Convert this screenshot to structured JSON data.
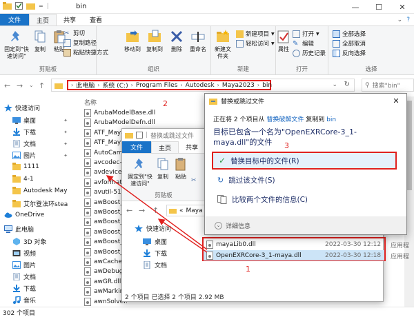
{
  "window": {
    "title": "bin"
  },
  "tabs": [
    "文件",
    "主页",
    "共享",
    "查看"
  ],
  "ribbon": {
    "clipboard": {
      "group": "剪贴板",
      "pin": "固定到\"快速访问\"",
      "copy": "复制",
      "paste": "粘贴",
      "cut": "剪切",
      "copy_path": "复制路径",
      "paste_shortcut": "粘贴快捷方式"
    },
    "organize": {
      "group": "组织",
      "move_to": "移动到",
      "copy_to": "复制到",
      "delete": "删除",
      "rename": "重命名"
    },
    "new": {
      "group": "新建",
      "new_folder": "新建文件夹",
      "new_item": "新建项目",
      "easy_access": "轻松访问"
    },
    "open": {
      "group": "打开",
      "properties": "属性",
      "open": "打开",
      "edit": "编辑",
      "history": "历史记录"
    },
    "select": {
      "group": "选择",
      "select_all": "全部选择",
      "select_none": "全部取消",
      "invert": "反向选择"
    }
  },
  "address": {
    "crumbs": [
      "此电脑",
      "系统 (C:)",
      "Program Files",
      "Autodesk",
      "Maya2023",
      "bin"
    ],
    "search_placeholder": "搜索\"bin\""
  },
  "annotations": {
    "n1": "1",
    "n2": "2",
    "n3": "3"
  },
  "nav": [
    {
      "label": "快速访问",
      "icon": "star-icon",
      "pin": false
    },
    {
      "label": "桌面",
      "icon": "desktop-folder-icon",
      "pin": true
    },
    {
      "label": "下载",
      "icon": "download-icon",
      "pin": true
    },
    {
      "label": "文档",
      "icon": "document-folder-icon",
      "pin": true
    },
    {
      "label": "图片",
      "icon": "picture-folder-icon",
      "pin": true
    },
    {
      "label": "1111",
      "icon": "folder-icon",
      "pin": false
    },
    {
      "label": "4-1",
      "icon": "folder-icon",
      "pin": false
    },
    {
      "label": "Autodesk Maya",
      "icon": "folder-icon",
      "pin": false
    },
    {
      "label": "艾尔登法环stea",
      "icon": "folder-icon",
      "pin": false
    },
    {
      "label": "OneDrive",
      "icon": "cloud-icon",
      "pin": false
    },
    {
      "label": "此电脑",
      "icon": "computer-icon",
      "pin": false
    },
    {
      "label": "3D 对象",
      "icon": "3d-objects-icon",
      "pin": false
    },
    {
      "label": "视频",
      "icon": "video-icon",
      "pin": false
    },
    {
      "label": "图片",
      "icon": "picture-folder-icon",
      "pin": false
    },
    {
      "label": "文档",
      "icon": "document-folder-icon",
      "pin": false
    },
    {
      "label": "下载",
      "icon": "download-icon",
      "pin": false
    },
    {
      "label": "音乐",
      "icon": "music-icon",
      "pin": false
    },
    {
      "label": "桌面",
      "icon": "desktop-folder-icon",
      "pin": false
    }
  ],
  "filelist": {
    "col_name": "名称",
    "files": [
      "ArubaModelBase.dll",
      "ArubaModelDefn.dll",
      "ATF_Maya_",
      "ATF_Maya_",
      "AutoCam.d",
      "avcodec-5",
      "avdevice-5",
      "avformat-5",
      "avutil-51.d",
      "awBoost_fi",
      "awBoost_p",
      "awBoost_p",
      "awBoost_p",
      "awBoost_sy",
      "awBoost_th",
      "awCache.dl",
      "awDebugT",
      "awGR.dll",
      "awMarking",
      "awnSolver."
    ]
  },
  "status": {
    "count": "302 个项目"
  },
  "second_window": {
    "title": "替换或跳过文件",
    "tabs": [
      "文件",
      "主页",
      "共享"
    ],
    "ribbon": {
      "pin": "固定到\"快速访问\"",
      "copy": "复制",
      "paste": "粘贴",
      "group": "剪贴板"
    },
    "address_prefix": "«",
    "address": "Maya",
    "nav": [
      {
        "label": "快速访问",
        "icon": "star-icon"
      },
      {
        "label": "桌面",
        "icon": "desktop-folder-icon"
      },
      {
        "label": "下载",
        "icon": "download-icon"
      },
      {
        "label": "文档",
        "icon": "document-folder-icon"
      }
    ],
    "status": "2 个项目    已选择 2 个项目  2.92 MB"
  },
  "selected_files": [
    {
      "name": "mayaLib0.dll",
      "date": "2022-03-30 12:12",
      "type": "应用程"
    },
    {
      "name": "OpenEXRCore-3_1-maya.dll",
      "date": "2022-03-30 12:18",
      "type": "应用程"
    }
  ],
  "dialog": {
    "title": "替换或跳过文件",
    "line_pre": "正在将 2 个项目从",
    "line_link1": "替换破解文件",
    "line_mid": "复制到",
    "line_link2": "bin",
    "main": "目标已包含一个名为\"OpenEXRCore-3_1-maya.dll\"的文件",
    "opt_replace": "替换目标中的文件(R)",
    "opt_skip": "跳过该文件(S)",
    "opt_compare": "比较两个文件的信息(C)",
    "more": "详细信息"
  }
}
